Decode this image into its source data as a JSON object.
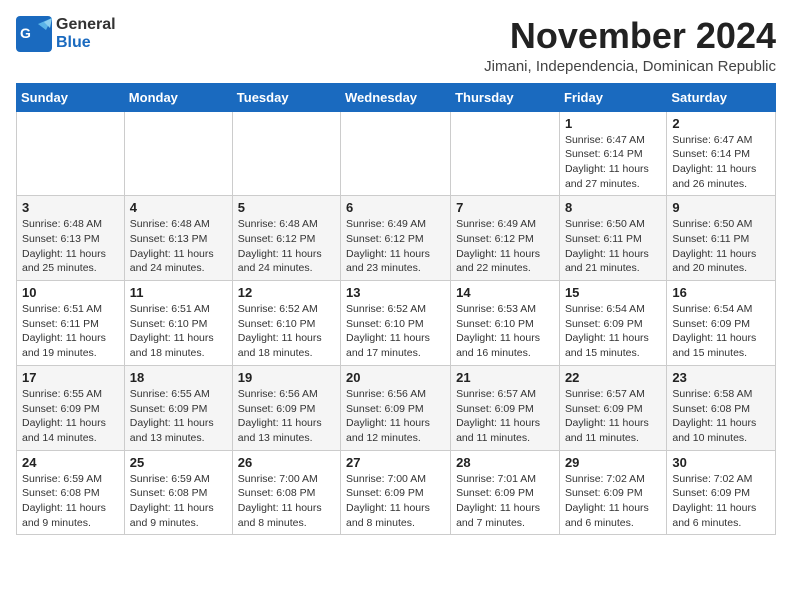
{
  "header": {
    "logo_general": "General",
    "logo_blue": "Blue",
    "month_title": "November 2024",
    "subtitle": "Jimani, Independencia, Dominican Republic"
  },
  "weekdays": [
    "Sunday",
    "Monday",
    "Tuesday",
    "Wednesday",
    "Thursday",
    "Friday",
    "Saturday"
  ],
  "weeks": [
    [
      {
        "day": "",
        "info": ""
      },
      {
        "day": "",
        "info": ""
      },
      {
        "day": "",
        "info": ""
      },
      {
        "day": "",
        "info": ""
      },
      {
        "day": "",
        "info": ""
      },
      {
        "day": "1",
        "info": "Sunrise: 6:47 AM\nSunset: 6:14 PM\nDaylight: 11 hours and 27 minutes."
      },
      {
        "day": "2",
        "info": "Sunrise: 6:47 AM\nSunset: 6:14 PM\nDaylight: 11 hours and 26 minutes."
      }
    ],
    [
      {
        "day": "3",
        "info": "Sunrise: 6:48 AM\nSunset: 6:13 PM\nDaylight: 11 hours and 25 minutes."
      },
      {
        "day": "4",
        "info": "Sunrise: 6:48 AM\nSunset: 6:13 PM\nDaylight: 11 hours and 24 minutes."
      },
      {
        "day": "5",
        "info": "Sunrise: 6:48 AM\nSunset: 6:12 PM\nDaylight: 11 hours and 24 minutes."
      },
      {
        "day": "6",
        "info": "Sunrise: 6:49 AM\nSunset: 6:12 PM\nDaylight: 11 hours and 23 minutes."
      },
      {
        "day": "7",
        "info": "Sunrise: 6:49 AM\nSunset: 6:12 PM\nDaylight: 11 hours and 22 minutes."
      },
      {
        "day": "8",
        "info": "Sunrise: 6:50 AM\nSunset: 6:11 PM\nDaylight: 11 hours and 21 minutes."
      },
      {
        "day": "9",
        "info": "Sunrise: 6:50 AM\nSunset: 6:11 PM\nDaylight: 11 hours and 20 minutes."
      }
    ],
    [
      {
        "day": "10",
        "info": "Sunrise: 6:51 AM\nSunset: 6:11 PM\nDaylight: 11 hours and 19 minutes."
      },
      {
        "day": "11",
        "info": "Sunrise: 6:51 AM\nSunset: 6:10 PM\nDaylight: 11 hours and 18 minutes."
      },
      {
        "day": "12",
        "info": "Sunrise: 6:52 AM\nSunset: 6:10 PM\nDaylight: 11 hours and 18 minutes."
      },
      {
        "day": "13",
        "info": "Sunrise: 6:52 AM\nSunset: 6:10 PM\nDaylight: 11 hours and 17 minutes."
      },
      {
        "day": "14",
        "info": "Sunrise: 6:53 AM\nSunset: 6:10 PM\nDaylight: 11 hours and 16 minutes."
      },
      {
        "day": "15",
        "info": "Sunrise: 6:54 AM\nSunset: 6:09 PM\nDaylight: 11 hours and 15 minutes."
      },
      {
        "day": "16",
        "info": "Sunrise: 6:54 AM\nSunset: 6:09 PM\nDaylight: 11 hours and 15 minutes."
      }
    ],
    [
      {
        "day": "17",
        "info": "Sunrise: 6:55 AM\nSunset: 6:09 PM\nDaylight: 11 hours and 14 minutes."
      },
      {
        "day": "18",
        "info": "Sunrise: 6:55 AM\nSunset: 6:09 PM\nDaylight: 11 hours and 13 minutes."
      },
      {
        "day": "19",
        "info": "Sunrise: 6:56 AM\nSunset: 6:09 PM\nDaylight: 11 hours and 13 minutes."
      },
      {
        "day": "20",
        "info": "Sunrise: 6:56 AM\nSunset: 6:09 PM\nDaylight: 11 hours and 12 minutes."
      },
      {
        "day": "21",
        "info": "Sunrise: 6:57 AM\nSunset: 6:09 PM\nDaylight: 11 hours and 11 minutes."
      },
      {
        "day": "22",
        "info": "Sunrise: 6:57 AM\nSunset: 6:09 PM\nDaylight: 11 hours and 11 minutes."
      },
      {
        "day": "23",
        "info": "Sunrise: 6:58 AM\nSunset: 6:08 PM\nDaylight: 11 hours and 10 minutes."
      }
    ],
    [
      {
        "day": "24",
        "info": "Sunrise: 6:59 AM\nSunset: 6:08 PM\nDaylight: 11 hours and 9 minutes."
      },
      {
        "day": "25",
        "info": "Sunrise: 6:59 AM\nSunset: 6:08 PM\nDaylight: 11 hours and 9 minutes."
      },
      {
        "day": "26",
        "info": "Sunrise: 7:00 AM\nSunset: 6:08 PM\nDaylight: 11 hours and 8 minutes."
      },
      {
        "day": "27",
        "info": "Sunrise: 7:00 AM\nSunset: 6:09 PM\nDaylight: 11 hours and 8 minutes."
      },
      {
        "day": "28",
        "info": "Sunrise: 7:01 AM\nSunset: 6:09 PM\nDaylight: 11 hours and 7 minutes."
      },
      {
        "day": "29",
        "info": "Sunrise: 7:02 AM\nSunset: 6:09 PM\nDaylight: 11 hours and 6 minutes."
      },
      {
        "day": "30",
        "info": "Sunrise: 7:02 AM\nSunset: 6:09 PM\nDaylight: 11 hours and 6 minutes."
      }
    ]
  ]
}
